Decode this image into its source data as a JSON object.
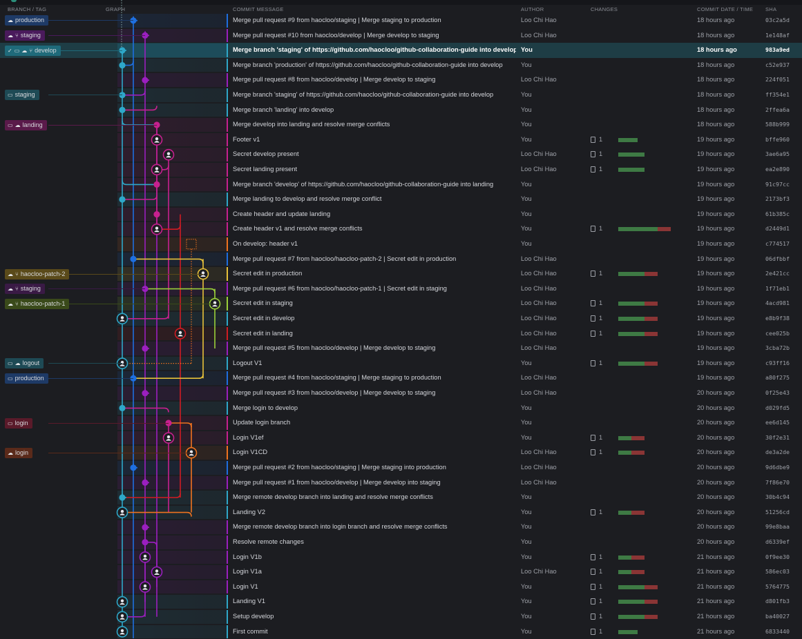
{
  "header": {
    "branch_tag": "BRANCH / TAG",
    "graph": "GRAPH",
    "message": "COMMIT MESSAGE",
    "author": "AUTHOR",
    "changes": "CHANGES",
    "date": "COMMIT DATE / TIME",
    "sha": "SHA"
  },
  "icons": {
    "check": "check-icon",
    "computer": "computer-icon",
    "cloud": "remote-avatar-icon",
    "pull_request": "pull-request-icon",
    "file": "file-icon"
  },
  "colors": {
    "cyan": "#2ea8c9",
    "blue": "#1e6fe0",
    "purple": "#9b1fbf",
    "magenta": "#c7208f",
    "red": "#d11c23",
    "orange": "#f0731f",
    "yellow": "#e8c23a",
    "green": "#9bd13a",
    "selected": "#1e5a6b"
  },
  "tags": [
    {
      "row": 0,
      "label": "production",
      "icons": [
        "cloud"
      ],
      "color": "#1e3a66"
    },
    {
      "row": 1,
      "label": "staging",
      "icons": [
        "cloud",
        "pull_request"
      ],
      "color": "#4a1a5c"
    },
    {
      "row": 2,
      "label": "develop",
      "icons": [
        "check",
        "computer",
        "cloud",
        "pull_request"
      ],
      "color": "#1f6a7a"
    },
    {
      "row": 5,
      "label": "staging",
      "icons": [
        "computer"
      ],
      "color": "#1e4a55"
    },
    {
      "row": 7,
      "label": "landing",
      "icons": [
        "computer",
        "cloud"
      ],
      "color": "#5a1a4a"
    },
    {
      "row": 17,
      "label": "haocloo-patch-2",
      "icons": [
        "cloud",
        "pull_request"
      ],
      "color": "#5a4a1a"
    },
    {
      "row": 18,
      "label": "staging",
      "icons": [
        "cloud",
        "pull_request"
      ],
      "color": "#3a1a45"
    },
    {
      "row": 19,
      "label": "haocloo-patch-1",
      "icons": [
        "cloud",
        "pull_request"
      ],
      "color": "#3a4a1a"
    },
    {
      "row": 23,
      "label": "logout",
      "icons": [
        "computer",
        "cloud"
      ],
      "color": "#1e4a55"
    },
    {
      "row": 24,
      "label": "production",
      "icons": [
        "computer"
      ],
      "color": "#1e3a66"
    },
    {
      "row": 27,
      "label": "login",
      "icons": [
        "computer"
      ],
      "color": "#5a1a2a"
    },
    {
      "row": 29,
      "label": "login",
      "icons": [
        "cloud"
      ],
      "color": "#5a2a1a"
    }
  ],
  "commits": [
    {
      "message": "Merge pull request #9 from haocloo/staging | Merge staging to production",
      "author": "Loo Chi Hao",
      "files": "",
      "add": 0,
      "del": 0,
      "date": "18 hours ago",
      "sha": "03c2a5d"
    },
    {
      "message": "Merge pull request #10 from haocloo/develop | Merge develop to staging",
      "author": "Loo Chi Hao",
      "files": "",
      "add": 0,
      "del": 0,
      "date": "18 hours ago",
      "sha": "1e148af"
    },
    {
      "message": "Merge branch 'staging' of https://github.com/haocloo/github-collaboration-guide into develop",
      "author": "You",
      "files": "",
      "add": 0,
      "del": 0,
      "date": "18 hours ago",
      "sha": "983a9ed"
    },
    {
      "message": "Merge branch 'production' of https://github.com/haocloo/github-collaboration-guide into develop",
      "author": "You",
      "files": "",
      "add": 0,
      "del": 0,
      "date": "18 hours ago",
      "sha": "c52e937"
    },
    {
      "message": "Merge pull request #8 from haocloo/develop | Merge develop to staging",
      "author": "Loo Chi Hao",
      "files": "",
      "add": 0,
      "del": 0,
      "date": "18 hours ago",
      "sha": "224f051"
    },
    {
      "message": "Merge branch 'staging' of https://github.com/haocloo/github-collaboration-guide into develop",
      "author": "You",
      "files": "",
      "add": 0,
      "del": 0,
      "date": "18 hours ago",
      "sha": "ff354e1"
    },
    {
      "message": "Merge branch 'landing' into develop",
      "author": "You",
      "files": "",
      "add": 0,
      "del": 0,
      "date": "18 hours ago",
      "sha": "2ffea6a"
    },
    {
      "message": "Merge develop into landing and resolve merge conflicts",
      "author": "You",
      "files": "",
      "add": 0,
      "del": 0,
      "date": "18 hours ago",
      "sha": "588b999"
    },
    {
      "message": "Footer v1",
      "author": "You",
      "files": "1",
      "add": 28,
      "del": 0,
      "date": "19 hours ago",
      "sha": "bffe960"
    },
    {
      "message": "Secret develop present",
      "author": "Loo Chi Hao",
      "files": "1",
      "add": 38,
      "del": 0,
      "date": "19 hours ago",
      "sha": "3ae6a95"
    },
    {
      "message": "Secret landing present",
      "author": "Loo Chi Hao",
      "files": "1",
      "add": 38,
      "del": 0,
      "date": "19 hours ago",
      "sha": "ea2e890"
    },
    {
      "message": "Merge branch 'develop' of https://github.com/haocloo/github-collaboration-guide into landing",
      "author": "You",
      "files": "",
      "add": 0,
      "del": 0,
      "date": "19 hours ago",
      "sha": "91c97cc"
    },
    {
      "message": "Merge landing to develop and resolve merge conflict",
      "author": "You",
      "files": "",
      "add": 0,
      "del": 0,
      "date": "19 hours ago",
      "sha": "2173bf3"
    },
    {
      "message": "Create header and update landing",
      "author": "You",
      "files": "",
      "add": 0,
      "del": 0,
      "date": "19 hours ago",
      "sha": "61b385c"
    },
    {
      "message": "Create header v1 and resolve merge conflicts",
      "author": "You",
      "files": "1",
      "add": 57,
      "del": 19,
      "date": "19 hours ago",
      "sha": "d2449d1"
    },
    {
      "message": "On develop: header v1",
      "author": "You",
      "files": "",
      "add": 0,
      "del": 0,
      "date": "19 hours ago",
      "sha": "c774517"
    },
    {
      "message": "Merge pull request #7 from haocloo/haocloo-patch-2 | Secret edit in production",
      "author": "Loo Chi Hao",
      "files": "",
      "add": 0,
      "del": 0,
      "date": "19 hours ago",
      "sha": "06dfbbf"
    },
    {
      "message": "Secret edit in production",
      "author": "Loo Chi Hao",
      "files": "1",
      "add": 38,
      "del": 19,
      "date": "19 hours ago",
      "sha": "2e421cc"
    },
    {
      "message": "Merge pull request #6 from haocloo/haocloo-patch-1 | Secret edit in staging",
      "author": "Loo Chi Hao",
      "files": "",
      "add": 0,
      "del": 0,
      "date": "19 hours ago",
      "sha": "1f71eb1"
    },
    {
      "message": "Secret edit in staging",
      "author": "Loo Chi Hao",
      "files": "1",
      "add": 38,
      "del": 19,
      "date": "19 hours ago",
      "sha": "4acd981"
    },
    {
      "message": "Secret edit in develop",
      "author": "Loo Chi Hao",
      "files": "1",
      "add": 38,
      "del": 19,
      "date": "19 hours ago",
      "sha": "e8b9f38"
    },
    {
      "message": "Secret edit in landing",
      "author": "Loo Chi Hao",
      "files": "1",
      "add": 38,
      "del": 19,
      "date": "19 hours ago",
      "sha": "cee025b"
    },
    {
      "message": "Merge pull request #5 from haocloo/develop | Merge develop to staging",
      "author": "Loo Chi Hao",
      "files": "",
      "add": 0,
      "del": 0,
      "date": "19 hours ago",
      "sha": "3cba72b"
    },
    {
      "message": "Logout V1",
      "author": "You",
      "files": "1",
      "add": 38,
      "del": 19,
      "date": "19 hours ago",
      "sha": "c93ff16"
    },
    {
      "message": "Merge pull request #4 from haocloo/staging | Merge staging to production",
      "author": "Loo Chi Hao",
      "files": "",
      "add": 0,
      "del": 0,
      "date": "19 hours ago",
      "sha": "a80f275"
    },
    {
      "message": "Merge pull request #3 from haocloo/develop | Merge develop to staging",
      "author": "Loo Chi Hao",
      "files": "",
      "add": 0,
      "del": 0,
      "date": "20 hours ago",
      "sha": "0f25e43"
    },
    {
      "message": "Merge login to develop",
      "author": "You",
      "files": "",
      "add": 0,
      "del": 0,
      "date": "20 hours ago",
      "sha": "d029fd5"
    },
    {
      "message": "Update login branch",
      "author": "You",
      "files": "",
      "add": 0,
      "del": 0,
      "date": "20 hours ago",
      "sha": "ee6d145"
    },
    {
      "message": "Login V1ef",
      "author": "You",
      "files": "1",
      "add": 19,
      "del": 19,
      "date": "20 hours ago",
      "sha": "30f2e31"
    },
    {
      "message": "Login V1CD",
      "author": "Loo Chi Hao",
      "files": "1",
      "add": 19,
      "del": 19,
      "date": "20 hours ago",
      "sha": "de3a2de"
    },
    {
      "message": "Merge pull request #2 from haocloo/staging | Merge staging into production",
      "author": "Loo Chi Hao",
      "files": "",
      "add": 0,
      "del": 0,
      "date": "20 hours ago",
      "sha": "9d6dbe9"
    },
    {
      "message": "Merge pull request #1 from haocloo/develop | Merge develop into staging",
      "author": "Loo Chi Hao",
      "files": "",
      "add": 0,
      "del": 0,
      "date": "20 hours ago",
      "sha": "7f86e70"
    },
    {
      "message": "Merge remote develop branch into landing and resolve merge conflicts",
      "author": "You",
      "files": "",
      "add": 0,
      "del": 0,
      "date": "20 hours ago",
      "sha": "30b4c94"
    },
    {
      "message": "Landing V2",
      "author": "You",
      "files": "1",
      "add": 19,
      "del": 19,
      "date": "20 hours ago",
      "sha": "51256cd"
    },
    {
      "message": "Merge remote develop branch into login branch and resolve merge conflicts",
      "author": "You",
      "files": "",
      "add": 0,
      "del": 0,
      "date": "20 hours ago",
      "sha": "99e8baa"
    },
    {
      "message": "Resolve remote changes",
      "author": "You",
      "files": "",
      "add": 0,
      "del": 0,
      "date": "20 hours ago",
      "sha": "d6339ef"
    },
    {
      "message": "Login V1b",
      "author": "You",
      "files": "1",
      "add": 19,
      "del": 19,
      "date": "21 hours ago",
      "sha": "0f9ee30"
    },
    {
      "message": "Login V1a",
      "author": "Loo Chi Hao",
      "files": "1",
      "add": 19,
      "del": 19,
      "date": "21 hours ago",
      "sha": "586ec03"
    },
    {
      "message": "Login V1",
      "author": "You",
      "files": "1",
      "add": 38,
      "del": 19,
      "date": "21 hours ago",
      "sha": "5764775"
    },
    {
      "message": "Landing V1",
      "author": "You",
      "files": "1",
      "add": 38,
      "del": 19,
      "date": "21 hours ago",
      "sha": "d801fb3"
    },
    {
      "message": "Setup develop",
      "author": "You",
      "files": "1",
      "add": 38,
      "del": 19,
      "date": "21 hours ago",
      "sha": "ba40027"
    },
    {
      "message": "First commit",
      "author": "You",
      "files": "1",
      "add": 28,
      "del": 0,
      "date": "21 hours ago",
      "sha": "6833440"
    }
  ]
}
